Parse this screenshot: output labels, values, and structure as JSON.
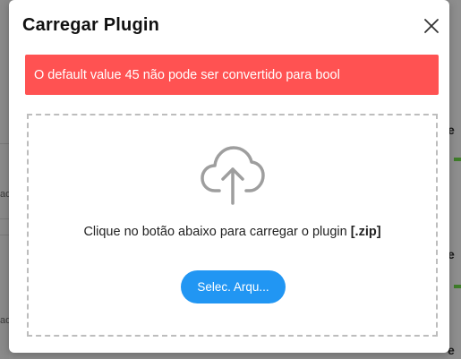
{
  "background": {
    "left_fragments": [
      "ad",
      "ad"
    ],
    "right_fragments": [
      "e",
      "e",
      "e"
    ]
  },
  "modal": {
    "title": "Carregar Plugin",
    "close_icon": "close-x-icon",
    "alert_message": "O default value 45 não pode ser convertido para bool",
    "alert_color": "#ff5252",
    "dropzone": {
      "icon": "cloud-upload-icon",
      "instruction": "Clique no botão abaixo para carregar o plugin",
      "extension": "[.zip]",
      "button_label": "Selec. Arqu..."
    },
    "accent_color": "#2196f3"
  }
}
